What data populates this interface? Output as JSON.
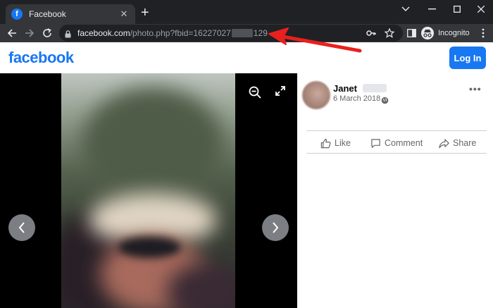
{
  "browser": {
    "tab_title": "Facebook",
    "tab_favicon": "f",
    "tab_close_glyph": "✕",
    "newtab_glyph": "+",
    "url_host": "facebook.com",
    "url_path_start": "/photo.php?fbid=16227027",
    "url_path_end": "129",
    "incognito_label": "Incognito"
  },
  "facebook": {
    "logo": "facebook",
    "login_label": "Log In",
    "brand_color": "#1877f2"
  },
  "post": {
    "author": "Janet",
    "date": "6 March 2018 ·",
    "more_glyph": "•••",
    "actions": [
      {
        "label": "Like",
        "icon": "like-icon"
      },
      {
        "label": "Comment",
        "icon": "comment-icon"
      },
      {
        "label": "Share",
        "icon": "share-icon"
      }
    ]
  },
  "annotation": {
    "arrow_color": "#e8201e"
  }
}
